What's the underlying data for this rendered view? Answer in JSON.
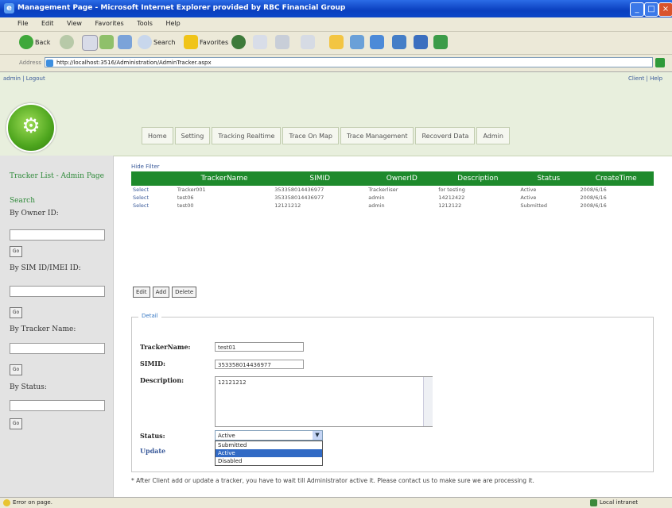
{
  "window": {
    "title": "Management Page - Microsoft Internet Explorer provided by RBC Financial Group"
  },
  "menu": [
    "File",
    "Edit",
    "View",
    "Favorites",
    "Tools",
    "Help"
  ],
  "toolbar": {
    "back": "Back",
    "search": "Search",
    "favorites": "Favorites"
  },
  "address": {
    "label": "Address",
    "url": "http://localhost:3516/Administration/AdminTracker.aspx"
  },
  "header": {
    "user_links": "admin | Logout",
    "right_links": "Client | Help",
    "nav": [
      "Home",
      "Setting",
      "Tracking Realtime",
      "Trace On Map",
      "Trace Management",
      "Recoverd Data",
      "Admin"
    ]
  },
  "sidebar": {
    "title": "Tracker List - Admin Page",
    "search": "Search",
    "filters": [
      "By Owner ID:",
      "By SIM ID/IMEI ID:",
      "By Tracker Name:",
      "By Status:"
    ],
    "go_label": "Go"
  },
  "grid": {
    "hide_filter": "Hide Filter",
    "columns": [
      "TrackerName",
      "SIMID",
      "OwnerID",
      "Description",
      "Status",
      "CreateTime"
    ],
    "select_label": "Select",
    "rows": [
      [
        "Tracker001",
        "353358014436977",
        "Trackerliser",
        "for testing",
        "Active",
        "2008/6/16"
      ],
      [
        "test06",
        "353358014436977",
        "admin",
        "14212422",
        "Active",
        "2008/6/16"
      ],
      [
        "test00",
        "12121212",
        "admin",
        "1212122",
        "Submitted",
        "2008/6/16"
      ]
    ]
  },
  "actions": {
    "edit": "Edit",
    "add": "Add",
    "delete": "Delete"
  },
  "detail": {
    "legend": "Detail",
    "tracker_name_label": "TrackerName:",
    "tracker_name": "test01",
    "simid_label": "SIMID:",
    "simid": "353358014436977",
    "description_label": "Description:",
    "description": "12121212",
    "status_label": "Status:",
    "status_value": "Active",
    "status_options": [
      "Submitted",
      "Active",
      "Disabled"
    ],
    "update": "Update"
  },
  "note": "* After Client add  or update a tracker, you have to wait till Administrator active it. Please contact us to make sure we are processing it.",
  "statusbar": {
    "left": "Error on page.",
    "right": "Local intranet"
  }
}
